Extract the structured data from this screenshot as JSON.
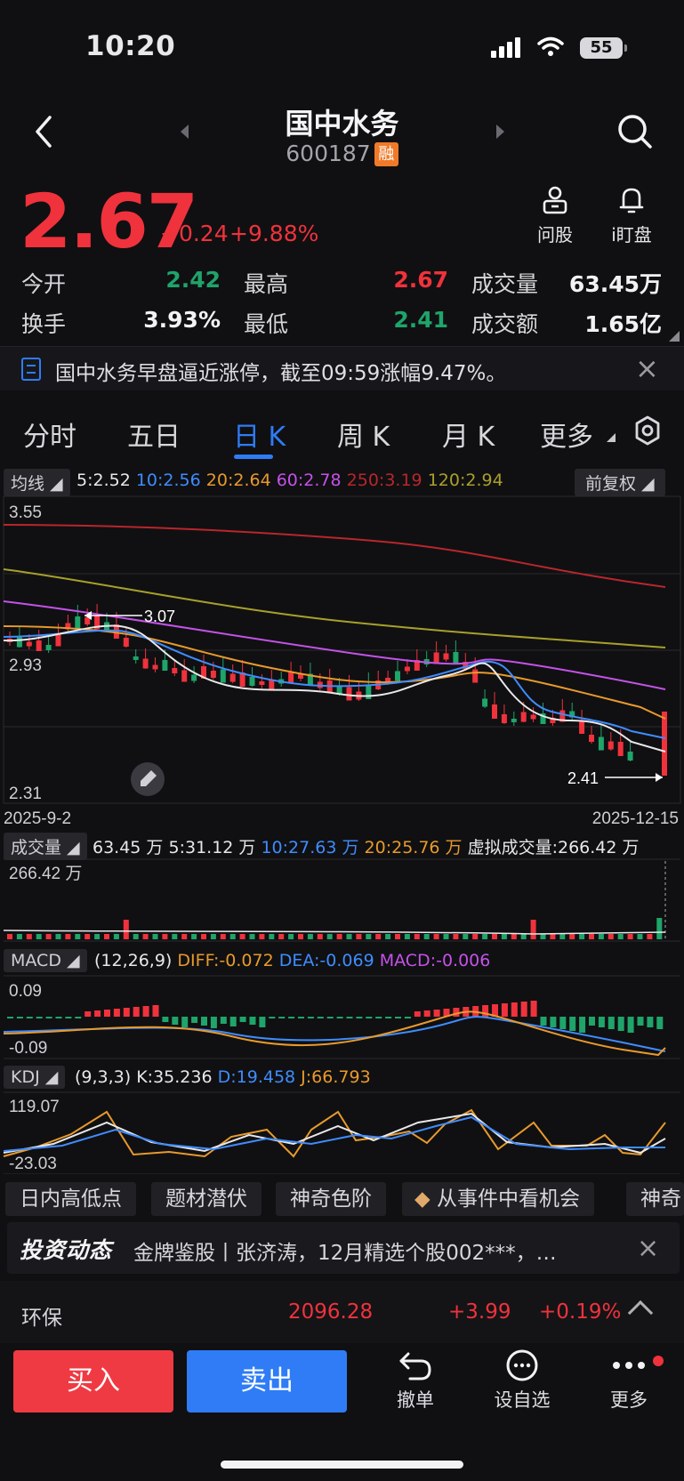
{
  "status": {
    "time": "10:20",
    "battery": "55"
  },
  "header": {
    "name": "国中水务",
    "code": "600187",
    "badge": "融"
  },
  "quote": {
    "price": "2.67",
    "change": "+0.24",
    "change_pct": "+9.88%",
    "ask_label": "问股",
    "watch_label": "i盯盘",
    "rows": [
      {
        "l1": "今开",
        "v1": "2.42",
        "l2": "最高",
        "v2": "2.67",
        "l3": "成交量",
        "v3": "63.45万"
      },
      {
        "l1": "换手",
        "v1": "3.93%",
        "l2": "最低",
        "v2": "2.41",
        "l3": "成交额",
        "v3": "1.65亿"
      }
    ]
  },
  "alert": {
    "text": "国中水务早盘逼近涨停，截至09:59涨幅9.47%。"
  },
  "tabs": [
    "分时",
    "五日",
    "日 K",
    "周 K",
    "月 K",
    "更多"
  ],
  "ma": {
    "button": "均线",
    "items": [
      {
        "text": "5:2.52",
        "color": "#e8e8ea"
      },
      {
        "text": "10:2.56",
        "color": "#3f8cff"
      },
      {
        "text": "20:2.64",
        "color": "#e89a2c"
      },
      {
        "text": "60:2.78",
        "color": "#c452e8"
      },
      {
        "text": "250:3.19",
        "color": "#b8262c"
      },
      {
        "text": "120:2.94",
        "color": "#a8a02a"
      }
    ],
    "adjust": "前复权"
  },
  "kline": {
    "y_top": "3.55",
    "y_mid": "2.93",
    "y_bottom": "2.31",
    "high_mark": "3.07",
    "low_mark": "2.41",
    "date_start": "2025-9-2",
    "date_end": "2025-12-15"
  },
  "volume": {
    "button": "成交量",
    "items": [
      {
        "text": "63.45 万",
        "color": "#e8e8ea"
      },
      {
        "text": "5:31.12 万",
        "color": "#e8e8ea"
      },
      {
        "text": "10:27.63 万",
        "color": "#3f8cff"
      },
      {
        "text": "20:25.76 万",
        "color": "#e89a2c"
      },
      {
        "text": "虚拟成交量:266.42 万",
        "color": "#e8e8ea"
      }
    ],
    "y_top": "266.42 万"
  },
  "macd": {
    "button": "MACD",
    "items": [
      {
        "text": "(12,26,9)",
        "color": "#e8e8ea"
      },
      {
        "text": "DIFF:-0.072",
        "color": "#e89a2c"
      },
      {
        "text": "DEA:-0.069",
        "color": "#3f8cff"
      },
      {
        "text": "MACD:-0.006",
        "color": "#c452e8"
      }
    ],
    "y_top": "0.09",
    "y_bottom": "-0.09"
  },
  "kdj": {
    "button": "KDJ",
    "items": [
      {
        "text": "(9,3,3)",
        "color": "#e8e8ea"
      },
      {
        "text": "K:35.236",
        "color": "#e8e8ea"
      },
      {
        "text": "D:19.458",
        "color": "#3f8cff"
      },
      {
        "text": "J:66.793",
        "color": "#e89a2c"
      }
    ],
    "y_top": "119.07",
    "y_bottom": "-23.03"
  },
  "chips": [
    "日内高低点",
    "题材潜伏",
    "神奇色阶",
    "从事件中看机会",
    "神奇"
  ],
  "news": {
    "logo": "投资动态",
    "text": "金牌鉴股丨张济涛，12月精选个股002***，…"
  },
  "sector": {
    "name": "环保",
    "price": "2096.28",
    "change": "+3.99",
    "pct": "+0.19%"
  },
  "bottom": {
    "buy": "买入",
    "sell": "卖出",
    "cancel": "撤单",
    "watchlist": "设自选",
    "more": "更多"
  }
}
